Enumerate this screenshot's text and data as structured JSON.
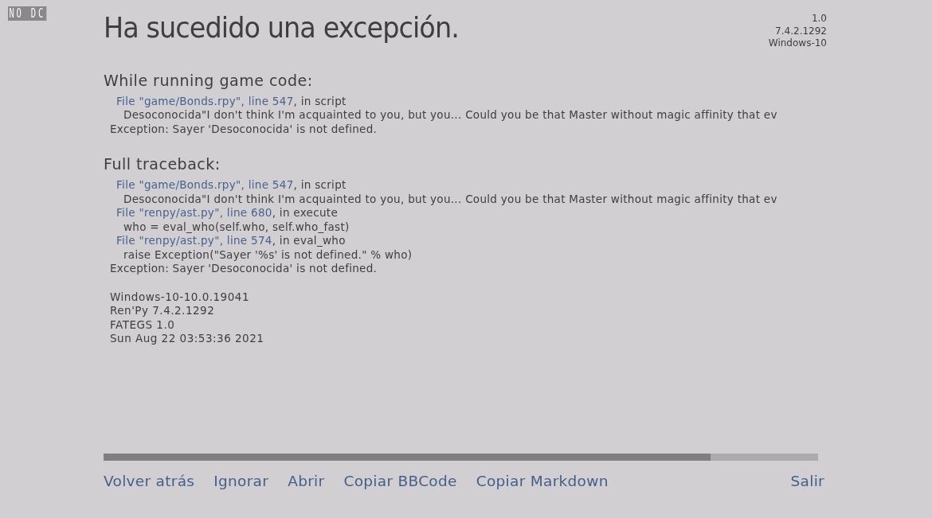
{
  "overlay": "NO DC",
  "title": "Ha sucedido una excepción.",
  "version_info": [
    "1.0",
    "7.4.2.1292",
    "Windows-10"
  ],
  "sections": [
    {
      "heading": "While running game code:",
      "lines": [
        {
          "kind": "file",
          "link": "File \"game/Bonds.rpy\", line 547",
          "text": ", in script"
        },
        {
          "kind": "code",
          "text": "Desoconocida\"I don't think I'm acquainted to you, but you... Could you be that Master without magic affinity that ev"
        },
        {
          "kind": "exception",
          "text": "Exception: Sayer 'Desoconocida' is not defined."
        }
      ]
    },
    {
      "heading": "Full traceback:",
      "lines": [
        {
          "kind": "file",
          "link": "File \"game/Bonds.rpy\", line 547",
          "text": ", in script"
        },
        {
          "kind": "code",
          "text": "Desoconocida\"I don't think I'm acquainted to you, but you... Could you be that Master without magic affinity that ev"
        },
        {
          "kind": "file",
          "link": "File \"renpy/ast.py\", line 680",
          "text": ", in execute"
        },
        {
          "kind": "code",
          "text": "who = eval_who(self.who, self.who_fast)"
        },
        {
          "kind": "file",
          "link": "File \"renpy/ast.py\", line 574",
          "text": ", in eval_who"
        },
        {
          "kind": "code",
          "text": "raise Exception(\"Sayer '%s' is not defined.\" % who)"
        },
        {
          "kind": "exception",
          "text": "Exception: Sayer 'Desoconocida' is not defined."
        }
      ]
    }
  ],
  "system_info": [
    "Windows-10-10.0.19041",
    "Ren'Py 7.4.2.1292",
    "FATEGS 1.0",
    "Sun Aug 22 03:53:36 2021"
  ],
  "actions": [
    "Volver atrás",
    "Ignorar",
    "Abrir",
    "Copiar BBCode",
    "Copiar Markdown"
  ],
  "exit": "Salir"
}
